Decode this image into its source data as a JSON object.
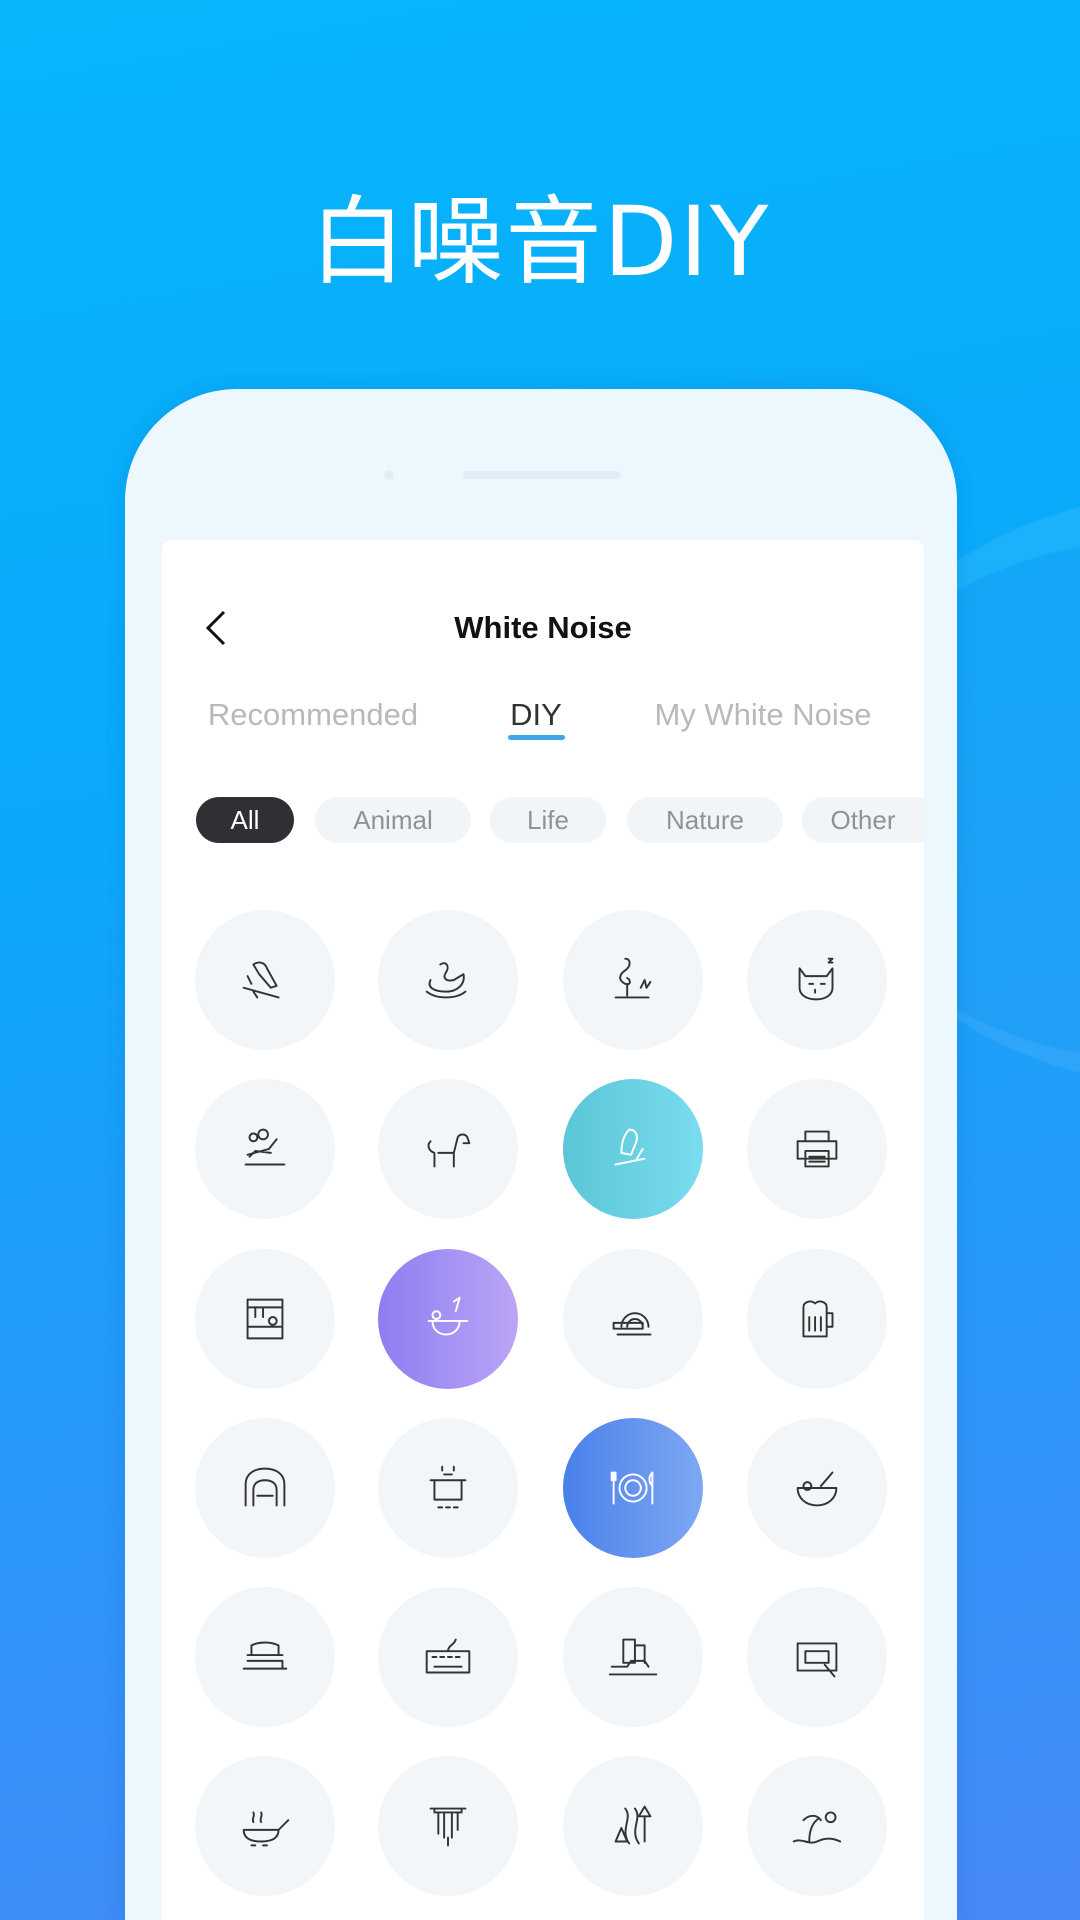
{
  "headline": "白噪音DIY",
  "header": {
    "title": "White Noise",
    "back_icon": "chevron-left-icon"
  },
  "tabs": [
    {
      "label": "Recommended",
      "active": false
    },
    {
      "label": "DIY",
      "active": true
    },
    {
      "label": "My White Noise",
      "active": false
    }
  ],
  "chips": [
    {
      "label": "All",
      "active": true
    },
    {
      "label": "Animal",
      "active": false
    },
    {
      "label": "Life",
      "active": false
    },
    {
      "label": "Nature",
      "active": false
    },
    {
      "label": "Other",
      "active": false
    }
  ],
  "colors": {
    "accent": "#3ea6ea",
    "teal": "#5ccbd9",
    "purple": "#9a85f2",
    "blue": "#4f86ea"
  },
  "sounds": [
    {
      "icon": "parrot-icon",
      "selected": null
    },
    {
      "icon": "swan-icon",
      "selected": null
    },
    {
      "icon": "flamingo-icon",
      "selected": null
    },
    {
      "icon": "sleeping-cat-icon",
      "selected": null
    },
    {
      "icon": "cricket-icon",
      "selected": null
    },
    {
      "icon": "dog-icon",
      "selected": null
    },
    {
      "icon": "bird-on-branch-icon",
      "selected": "teal"
    },
    {
      "icon": "printer-icon",
      "selected": null
    },
    {
      "icon": "kitchen-stall-icon",
      "selected": null
    },
    {
      "icon": "cooking-pan-icon",
      "selected": "purple"
    },
    {
      "icon": "saw-icon",
      "selected": null
    },
    {
      "icon": "beer-mug-icon",
      "selected": null
    },
    {
      "icon": "train-tunnel-icon",
      "selected": null
    },
    {
      "icon": "boiling-pot-icon",
      "selected": null
    },
    {
      "icon": "dining-plate-icon",
      "selected": "blue"
    },
    {
      "icon": "mixing-bowl-icon",
      "selected": null
    },
    {
      "icon": "toothbrush-icon",
      "selected": null
    },
    {
      "icon": "keyboard-icon",
      "selected": null
    },
    {
      "icon": "city-traffic-icon",
      "selected": null
    },
    {
      "icon": "cash-register-icon",
      "selected": null
    },
    {
      "icon": "frying-pan-icon",
      "selected": null
    },
    {
      "icon": "wind-chime-icon",
      "selected": null
    },
    {
      "icon": "forest-river-icon",
      "selected": null
    },
    {
      "icon": "beach-sun-icon",
      "selected": null
    }
  ]
}
